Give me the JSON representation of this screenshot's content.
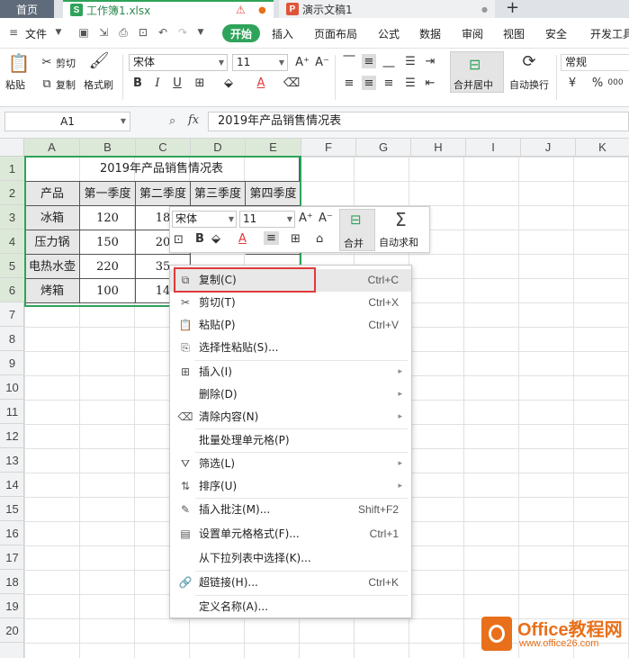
{
  "tabs": {
    "home": "首页",
    "workbook": "工作簿1.xlsx",
    "presentation": "演示文稿1",
    "new_tab": "+"
  },
  "menubar": {
    "file": "文件",
    "start": "开始",
    "items": [
      "插入",
      "页面布局",
      "公式",
      "数据",
      "审阅",
      "视图",
      "安全",
      "开发工具"
    ]
  },
  "ribbon": {
    "paste": "粘贴",
    "cut": "剪切",
    "copy": "复制",
    "format_painter": "格式刷",
    "font_name": "宋体",
    "font_size": "11",
    "merge_center": "合并居中",
    "wrap_text": "自动换行",
    "number_format": "常规",
    "bold": "B",
    "italic": "I",
    "underline": "U",
    "font_color": "A",
    "percent": "%",
    "thousands": "000"
  },
  "formula_bar": {
    "name_box": "A1",
    "fx": "fx",
    "content": "2019年产品销售情况表"
  },
  "columns": [
    "A",
    "B",
    "C",
    "D",
    "E",
    "F",
    "G",
    "H",
    "I",
    "J",
    "K"
  ],
  "rows": [
    "1",
    "2",
    "3",
    "4",
    "5",
    "6",
    "7",
    "8",
    "9",
    "10",
    "11",
    "12",
    "13",
    "14",
    "15",
    "16",
    "17",
    "18",
    "19",
    "20"
  ],
  "table": {
    "title": "2019年产品销售情况表",
    "headers": [
      "产品",
      "第一季度",
      "第二季度",
      "第三季度",
      "第四季度"
    ],
    "rows": [
      [
        "冰箱",
        "120",
        "18"
      ],
      [
        "压力锅",
        "150",
        "20"
      ],
      [
        "电热水壶",
        "220",
        "35"
      ],
      [
        "烤箱",
        "100",
        "14"
      ]
    ]
  },
  "mini_toolbar": {
    "font_name": "宋体",
    "font_size": "11",
    "merge": "合并",
    "autosum": "自动求和",
    "sigma": "Σ",
    "bold": "B",
    "font_color": "A"
  },
  "context_menu": {
    "items": [
      {
        "label": "复制(C)",
        "shortcut": "Ctrl+C"
      },
      {
        "label": "剪切(T)",
        "shortcut": "Ctrl+X"
      },
      {
        "label": "粘贴(P)",
        "shortcut": "Ctrl+V"
      },
      {
        "label": "选择性粘贴(S)...",
        "shortcut": ""
      },
      {
        "label": "插入(I)",
        "shortcut": ""
      },
      {
        "label": "删除(D)",
        "shortcut": ""
      },
      {
        "label": "清除内容(N)",
        "shortcut": ""
      },
      {
        "label": "批量处理单元格(P)",
        "shortcut": ""
      },
      {
        "label": "筛选(L)",
        "shortcut": ""
      },
      {
        "label": "排序(U)",
        "shortcut": ""
      },
      {
        "label": "插入批注(M)...",
        "shortcut": "Shift+F2"
      },
      {
        "label": "设置单元格格式(F)...",
        "shortcut": "Ctrl+1"
      },
      {
        "label": "从下拉列表中选择(K)...",
        "shortcut": ""
      },
      {
        "label": "超链接(H)...",
        "shortcut": "Ctrl+K"
      },
      {
        "label": "定义名称(A)...",
        "shortcut": ""
      }
    ]
  },
  "watermark": {
    "brand": "Office教程网",
    "url": "www.office26.com"
  },
  "colors": {
    "accent": "#2fa35a",
    "highlight": "#e03a3a",
    "brand": "#e8701a"
  }
}
